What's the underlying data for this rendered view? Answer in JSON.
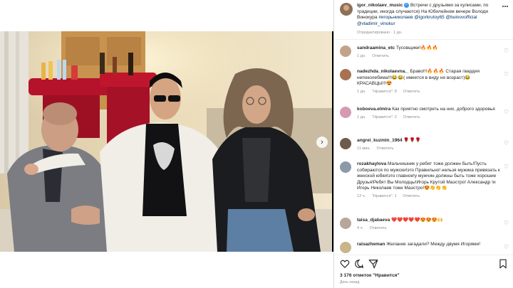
{
  "post": {
    "username": "igor_nikolaev_music",
    "caption_text": "Встречи с друзьями за кулисами, по традиции, иногда случаются) На Юбилейном вечере Володи Винокура",
    "hashtag": "#игорьниколаев",
    "mentions": "@igorkrutoy65 @buinovofficial @vladimir_vinokur",
    "edited": "Отредактировано",
    "time": "1 дн."
  },
  "comments": [
    {
      "user": "sandraamina_etc",
      "text": "Тусовщики!🔥🔥🔥",
      "time": "1 дн.",
      "likes": "",
      "reply": "Ответить"
    },
    {
      "user": "nadezhda_nikolaevna._",
      "text": "Браво!!!🔥🔥🔥 Старая гвардия непоколебима!!!😂😂( имеется в виду не возраст)😂 КРАСАВЦЫ!!!😍",
      "time": "1 дн.",
      "likes": "\"Нравится\": 8",
      "reply": "Ответить"
    },
    {
      "user": "koboeva.elmira",
      "text": "Как приятно смотреть на них, доброго здоровья",
      "time": "1 дн.",
      "likes": "\"Нравится\": 2",
      "reply": "Ответить"
    },
    {
      "user": "angrei_kuzmin_1964",
      "text": "🌹🌹🌹",
      "time": "11 мин.",
      "likes": "",
      "reply": "Ответить"
    },
    {
      "user": "rozakhaylova",
      "text": "Мальчишник у ребят тоже должен быть!Пусть собираются по мужски!это Правильно! нельзя мужика привязать к женской юбки!это главное!у мужчин должны быть тоже хорошие Друзья!Ребят Вы Молодцы!Игорь Крутой Маэстро! Александр !и Игорь Николаев тоже Маэстро!😍👏👏👏",
      "time": "12 ч.",
      "likes": "\"Нравится\": 1",
      "reply": "Ответить"
    },
    {
      "user": "taisa_djabaeva",
      "text": "❤️❤️❤️❤️❤️😍😍😍🙌",
      "time": "4 ч.",
      "likes": "",
      "reply": "Ответить"
    },
    {
      "user": "raisazheman",
      "text": "Желание загадали? Между двумя Игорями!",
      "time": "",
      "likes": "",
      "reply": ""
    }
  ],
  "footer": {
    "likes": "3 176 отметок \"Нравится\"",
    "date": "День назад"
  },
  "icons": {
    "more": "more-options-icon",
    "heart": "heart-icon",
    "comment": "comment-icon",
    "share": "share-icon",
    "save": "bookmark-icon",
    "next": "chevron-right-icon"
  }
}
